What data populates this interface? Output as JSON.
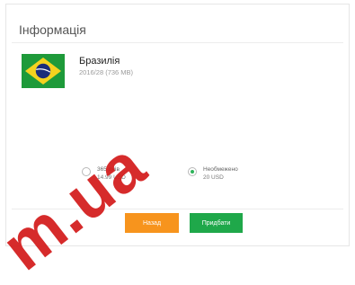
{
  "dialog": {
    "title": "Інформація"
  },
  "country": {
    "name": "Бразилія",
    "subtitle": "2016/28 (736 MB)",
    "flag_icon": "brazil-flag-icon"
  },
  "options": [
    {
      "line1": "365 днів",
      "line2": "14.99 USD",
      "checked": false
    },
    {
      "line1": "Необмежено",
      "line2": "20 USD",
      "checked": true
    }
  ],
  "buttons": {
    "cancel_label": "Назад",
    "continue_label": "Придбати"
  },
  "colors": {
    "cancel": "#f7941d",
    "continue": "#1fa84a",
    "watermark": "#d21919"
  },
  "watermark": {
    "text": "m.ua"
  }
}
